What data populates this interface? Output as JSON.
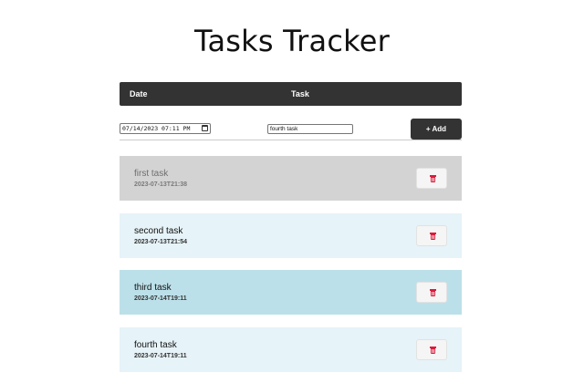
{
  "app": {
    "title": "Tasks Tracker"
  },
  "header": {
    "date_label": "Date",
    "task_label": "Task"
  },
  "form": {
    "date_value": "07/14/2023 07:11 PM",
    "task_value": "fourth task",
    "add_label": "+ Add"
  },
  "tasks": [
    {
      "name": "first task",
      "date": "2023-07-13T21:38"
    },
    {
      "name": "second task",
      "date": "2023-07-13T21:54"
    },
    {
      "name": "third task",
      "date": "2023-07-14T19:11"
    },
    {
      "name": "fourth task",
      "date": "2023-07-14T19:11"
    }
  ],
  "colors": {
    "header_bg": "#333333",
    "task_completed_bg": "#d3d3d3",
    "task_light_bg": "#e6f3f8",
    "task_highlight_bg": "#bce0e9",
    "delete_icon": "#dc1a3b"
  },
  "icons": {
    "delete": "trash-icon",
    "calendar": "calendar-icon"
  }
}
